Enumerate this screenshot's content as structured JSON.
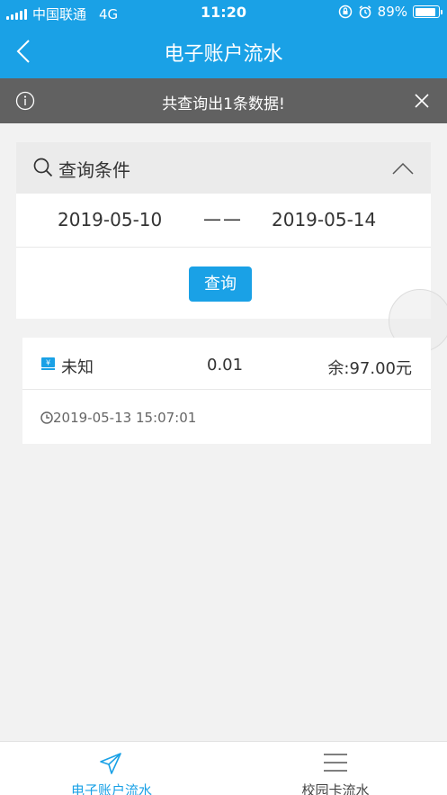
{
  "status_bar": {
    "carrier": "中国联通",
    "network": "4G",
    "time": "11:20",
    "battery": "89%",
    "battery_level": 0.89
  },
  "header": {
    "title": "电子账户流水",
    "back_icon": "chevron-left-icon"
  },
  "notice": {
    "text": "共查询出1条数据!",
    "info_icon": "info-icon",
    "close_icon": "close-icon"
  },
  "query": {
    "title": "查询条件",
    "start_date": "2019-05-10",
    "separator": "——",
    "end_date": "2019-05-14",
    "button_label": "查询"
  },
  "records": [
    {
      "type": "未知",
      "amount": "0.01",
      "balance": "余:97.00元",
      "time": "2019-05-13 15:07:01"
    }
  ],
  "tabbar": {
    "tabs": [
      {
        "label": "电子账户流水",
        "icon": "send-icon",
        "active": true
      },
      {
        "label": "校园卡流水",
        "icon": "menu-icon",
        "active": false
      }
    ]
  },
  "colors": {
    "primary": "#1aa1e6",
    "notice_bg": "#616161",
    "page_bg": "#f2f2f2"
  }
}
